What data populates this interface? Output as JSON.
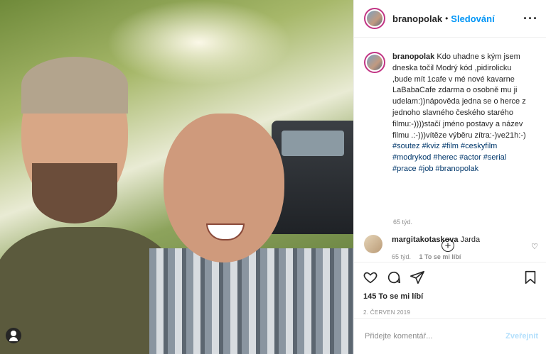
{
  "photo": {
    "alt_icon": "user-profile-icon"
  },
  "header": {
    "username": "branopolak",
    "separator": "•",
    "follow_label": "Sledování",
    "more_icon": "more-options-icon"
  },
  "caption": {
    "username": "branopolak",
    "text": "Kdo uhadne s kým jsem dneska točil Modrý kód ,pidirolicku ,bude mít 1cafe v mé nové kavarne LaBabaCafe zdarma o osobně mu ji udelam:))nápověda jedna se o herce z jednoho slavného českého starého filmu:-))))stačí jméno postavy a název filmu .:-)))vítěze výběru zítra:-)ve21h:-)",
    "tags": "#soutez #kviz #film #ceskyfilm #modrykod #herec #actor #serial #prace #job #branopolak",
    "time": "65 týd."
  },
  "load_more_icon": "plus-circle-icon",
  "comments": [
    {
      "username": "margitakotaskova",
      "text": "Jarda",
      "time": "65 týd.",
      "like_label": "1 To se mi líbí"
    }
  ],
  "actions": {
    "likes": "145 To se mi líbí",
    "date": "2. ČERVEN 2019"
  },
  "add_comment": {
    "placeholder": "Přidejte komentář...",
    "post_label": "Zveřejnit"
  }
}
